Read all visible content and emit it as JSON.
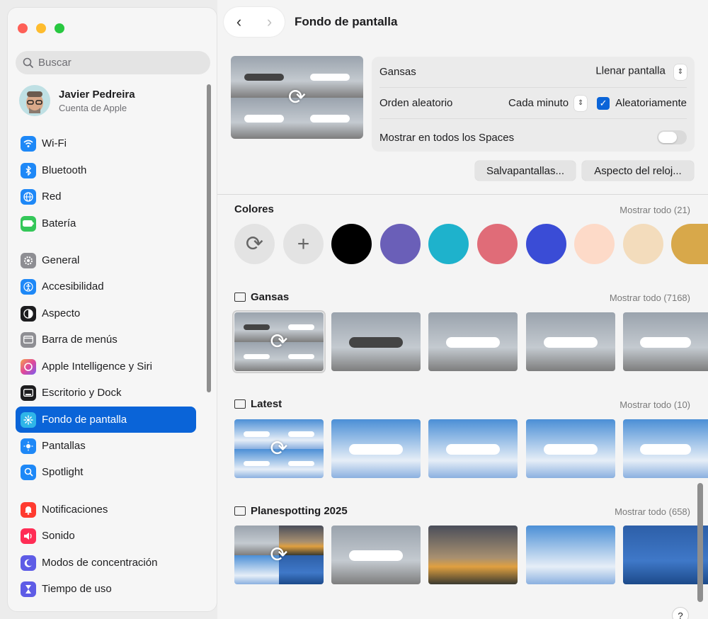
{
  "window": {
    "title": "Fondo de pantalla"
  },
  "search": {
    "placeholder": "Buscar"
  },
  "account": {
    "name": "Javier Pedreira",
    "subtitle": "Cuenta de Apple"
  },
  "sidebar": {
    "items": [
      {
        "label": "Wi-Fi",
        "icon": "wifi-icon",
        "color": "#1e88f7"
      },
      {
        "label": "Bluetooth",
        "icon": "bluetooth-icon",
        "color": "#1e88f7"
      },
      {
        "label": "Red",
        "icon": "globe-icon",
        "color": "#1e88f7"
      },
      {
        "label": "Batería",
        "icon": "battery-icon",
        "color": "#34c759"
      },
      {
        "label": "General",
        "icon": "gear-icon",
        "color": "#8e8e93"
      },
      {
        "label": "Accesibilidad",
        "icon": "accessibility-icon",
        "color": "#1e88f7"
      },
      {
        "label": "Aspecto",
        "icon": "appearance-icon",
        "color": "#1d1d1f"
      },
      {
        "label": "Barra de menús",
        "icon": "menubar-icon",
        "color": "#8e8e93"
      },
      {
        "label": "Apple Intelligence y Siri",
        "icon": "siri-icon",
        "color": "#c86ad8"
      },
      {
        "label": "Escritorio y Dock",
        "icon": "dock-icon",
        "color": "#1d1d1f"
      },
      {
        "label": "Fondo de pantalla",
        "icon": "wallpaper-icon",
        "color": "#2fb5e8"
      },
      {
        "label": "Pantallas",
        "icon": "display-icon",
        "color": "#1e88f7"
      },
      {
        "label": "Spotlight",
        "icon": "spotlight-icon",
        "color": "#1e88f7"
      },
      {
        "label": "Notificaciones",
        "icon": "bell-icon",
        "color": "#ff3b30"
      },
      {
        "label": "Sonido",
        "icon": "speaker-icon",
        "color": "#ff2d55"
      },
      {
        "label": "Modos de concentración",
        "icon": "moon-icon",
        "color": "#5e5ce6"
      },
      {
        "label": "Tiempo de uso",
        "icon": "hourglass-icon",
        "color": "#5e5ce6"
      }
    ],
    "active": "Fondo de pantalla"
  },
  "settings": {
    "album": "Gansas",
    "fill_mode": "Llenar pantalla",
    "order_label": "Orden aleatorio",
    "interval": "Cada minuto",
    "random_label": "Aleatoriamente",
    "random_checked": true,
    "all_spaces_label": "Mostrar en todos los Spaces",
    "all_spaces_on": false
  },
  "buttons": {
    "screensaver": "Salvapantallas...",
    "clock": "Aspecto del reloj..."
  },
  "sections": {
    "colors": {
      "title": "Colores",
      "show_all": "Mostrar todo (21)",
      "swatches": [
        "#000000",
        "#6a5fb8",
        "#1eb2cc",
        "#e06c78",
        "#3a4cd6",
        "#fddac8",
        "#f3dcbc",
        "#d8a84a"
      ]
    },
    "gansas": {
      "title": "Gansas",
      "show_all": "Mostrar todo (7168)"
    },
    "latest": {
      "title": "Latest",
      "show_all": "Mostrar todo (10)"
    },
    "planespotting": {
      "title": "Planespotting 2025",
      "show_all": "Mostrar todo (658)"
    }
  },
  "glyphs": {
    "back": "‹",
    "forward": "›",
    "cycle": "⟳",
    "plus": "+",
    "help": "?",
    "check": "✓",
    "updown": "⌃⌄"
  }
}
